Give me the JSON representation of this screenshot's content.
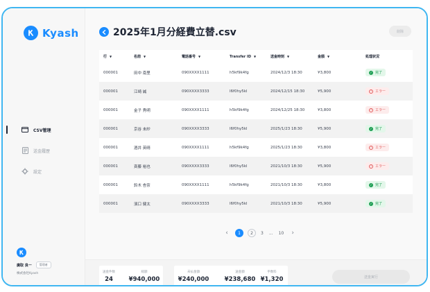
{
  "app": {
    "logo_text": "Kyash"
  },
  "sidebar": {
    "items": [
      {
        "label": "CSV管理",
        "icon": "card-icon",
        "active": true
      },
      {
        "label": "送金履歴",
        "icon": "document-icon",
        "active": false
      },
      {
        "label": "設定",
        "icon": "gear-icon",
        "active": false
      }
    ],
    "user": {
      "name": "廣取 良一",
      "role": "管理者",
      "company": "株式会社Kyash"
    }
  },
  "header": {
    "title": "2025年1月分経費立替.csv",
    "delete_label": "削除"
  },
  "table": {
    "columns": [
      "行",
      "名前",
      "電話番号",
      "Transfer ID",
      "送金時刻",
      "金額",
      "処理状況"
    ],
    "sortable": [
      true,
      true,
      true,
      true,
      true,
      true,
      false
    ],
    "rows": [
      {
        "row": "000001",
        "name": "田中 南里",
        "phone": "090XXXX1111",
        "transfer_id": "h5kf9k4fg",
        "time": "2024/12/3 18:30",
        "amount": "¥3,800",
        "status": "完了",
        "ok": true
      },
      {
        "row": "000001",
        "name": "江崎 誠",
        "phone": "090XXXX3333",
        "transfer_id": "l6f0hy5kl",
        "time": "2024/12/15 18:30",
        "amount": "¥5,900",
        "status": "エラー",
        "ok": false
      },
      {
        "row": "000001",
        "name": "金子 秀明",
        "phone": "090XXXX1111",
        "transfer_id": "h5kf9k4fg",
        "time": "2024/12/25 18:30",
        "amount": "¥3,800",
        "status": "エラー",
        "ok": false
      },
      {
        "row": "000001",
        "name": "京谷 未紗",
        "phone": "090XXXX3333",
        "transfer_id": "l6f0hy5kl",
        "time": "2025/1/23 18:30",
        "amount": "¥5,900",
        "status": "完了",
        "ok": true
      },
      {
        "row": "000001",
        "name": "酒井 英晴",
        "phone": "090XXXX1111",
        "transfer_id": "h5kf9k4fg",
        "time": "2025/1/23 18:30",
        "amount": "¥3,800",
        "status": "エラー",
        "ok": false
      },
      {
        "row": "000001",
        "name": "斉藤 裕也",
        "phone": "090XXXX3333",
        "transfer_id": "l6f0hy5kl",
        "time": "2021/10/3 18:30",
        "amount": "¥5,900",
        "status": "エラー",
        "ok": false
      },
      {
        "row": "000001",
        "name": "鈴木 杏奈",
        "phone": "090XXXX1111",
        "transfer_id": "h5kf9k4fg",
        "time": "2021/10/3 18:30",
        "amount": "¥3,800",
        "status": "完了",
        "ok": true
      },
      {
        "row": "000001",
        "name": "濱口 健太",
        "phone": "090XXXX3333",
        "transfer_id": "l6f0hy5kl",
        "time": "2021/10/3 18:30",
        "amount": "¥5,900",
        "status": "完了",
        "ok": true
      }
    ]
  },
  "pagination": {
    "pages": [
      "1",
      "2",
      "3",
      "...",
      "10"
    ],
    "current": "1"
  },
  "summary": {
    "count_label": "送金件数",
    "count_value": "24",
    "total_label": "総額",
    "total_value": "¥940,000",
    "unpaid_label": "未払金額",
    "unpaid_value": "¥240,000",
    "sent_label": "送金額",
    "sent_value": "¥238,680",
    "fee_label": "手数料",
    "fee_value": "¥1,320",
    "execute_label": "送金実行"
  },
  "colors": {
    "accent": "#1a8cff",
    "frame": "#3fb6f1",
    "ok": "#1f9e54",
    "error": "#e15a5a"
  }
}
